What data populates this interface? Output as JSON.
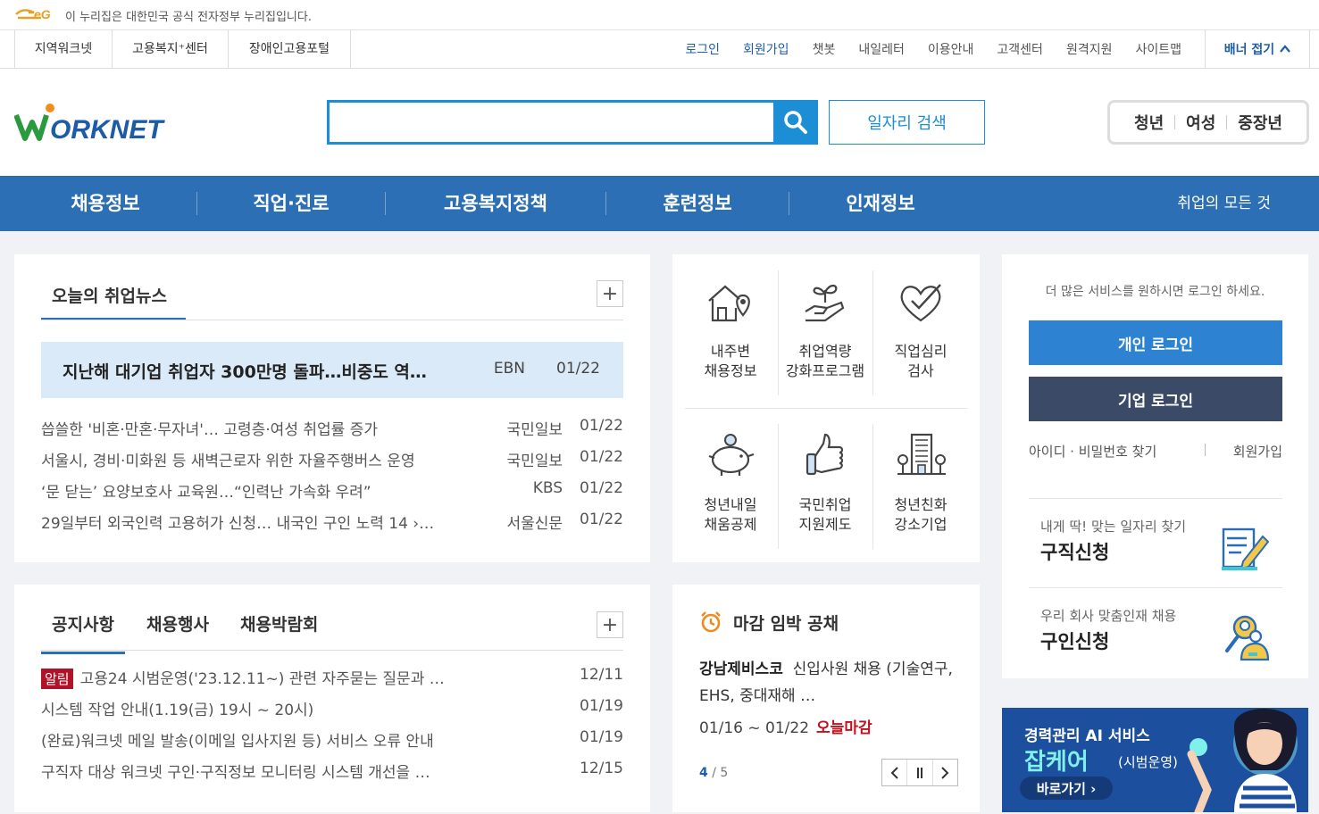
{
  "gov_bar": {
    "text": "이 누리집은 대한민국 공식 전자정부 누리집입니다."
  },
  "site_tabs": [
    "지역워크넷",
    "고용복지⁺센터",
    "장애인고용포털"
  ],
  "util_links": [
    {
      "label": "로그인",
      "highlight": true
    },
    {
      "label": "회원가입",
      "highlight": true
    },
    {
      "label": "챗봇",
      "highlight": false
    },
    {
      "label": "내일레터",
      "highlight": false
    },
    {
      "label": "이용안내",
      "highlight": false
    },
    {
      "label": "고객센터",
      "highlight": false
    },
    {
      "label": "원격지원",
      "highlight": false
    },
    {
      "label": "사이트맵",
      "highlight": false
    }
  ],
  "banner_fold": "배너 접기",
  "logo_text": "WORKNET",
  "search": {
    "value": "",
    "placeholder": ""
  },
  "job_search_button": "일자리 검색",
  "target_tabs": [
    "청년",
    "여성",
    "중장년"
  ],
  "gnb": [
    "채용정보",
    "직업·진로",
    "고용복지정책",
    "훈련정보",
    "인재정보"
  ],
  "gnb_all": "취업의 모든 것",
  "news": {
    "title": "오늘의 취업뉴스",
    "headline": {
      "title": "지난해 대기업 취업자 300만명 돌파…비중도 역…",
      "source": "EBN",
      "date": "01/22"
    },
    "items": [
      {
        "title": "씁쓸한 '비혼·만혼·무자녀'… 고령층·여성 취업률 증가",
        "source": "국민일보",
        "date": "01/22"
      },
      {
        "title": "서울시, 경비·미화원 등 새벽근로자 위한 자율주행버스 운영",
        "source": "국민일보",
        "date": "01/22"
      },
      {
        "title": "‘문 닫는’ 요양보호사 교육원…“인력난 가속화 우려”",
        "source": "KBS",
        "date": "01/22"
      },
      {
        "title": "29일부터 외국인력 고용허가 신청… 내국인 구인 노력 14  ›…",
        "source": "서울신문",
        "date": "01/22"
      }
    ]
  },
  "services": [
    {
      "line1": "내주변",
      "line2": "채용정보",
      "icon": "house-location-icon"
    },
    {
      "line1": "취업역량",
      "line2": "강화프로그램",
      "icon": "plant-hand-icon"
    },
    {
      "line1": "직업심리",
      "line2": "검사",
      "icon": "heart-check-icon"
    },
    {
      "line1": "청년내일",
      "line2": "채움공제",
      "icon": "piggy-bank-icon"
    },
    {
      "line1": "국민취업",
      "line2": "지원제도",
      "icon": "thumbs-up-icon"
    },
    {
      "line1": "청년친화",
      "line2": "강소기업",
      "icon": "building-icon"
    }
  ],
  "login": {
    "message": "더 많은 서비스를 원하시면 로그인 하세요.",
    "personal": "개인 로그인",
    "company": "기업 로그인",
    "find": "아이디 · 비밀번호 찾기",
    "join": "회원가입"
  },
  "quick": [
    {
      "sub": "내게 딱! 맞는 일자리 찾기",
      "main": "구직신청",
      "icon": "document-pen-icon"
    },
    {
      "sub": "우리 회사 맞춤인재 채용",
      "main": "구인신청",
      "icon": "person-search-icon"
    }
  ],
  "notice": {
    "tabs": [
      "공지사항",
      "채용행사",
      "채용박람회"
    ],
    "badge": "알림",
    "items": [
      {
        "title": "고용24 시범운영('23.12.11~) 관련 자주묻는 질문과 …",
        "date": "12/11",
        "badge": true
      },
      {
        "title": "시스템 작업 안내(1.19(금) 19시 ~ 20시)",
        "date": "01/19",
        "badge": false
      },
      {
        "title": "(완료)워크넷 메일 발송(이메일 입사지원 등) 서비스 오류 안내",
        "date": "01/19",
        "badge": false
      },
      {
        "title": "구직자 대상 워크넷 구인·구직정보 모니터링 시스템 개선을 …",
        "date": "12/15",
        "badge": false
      }
    ]
  },
  "deadline": {
    "title": "마감 임박 공채",
    "company": "강남제비스코",
    "desc": "신입사원 채용 (기술연구, EHS, 중대재해 …",
    "period": "01/16 ~ 01/22",
    "today": "오늘마감",
    "page_current": "4",
    "page_total": "/ 5"
  },
  "ai_banner": {
    "line1": "경력관리 AI 서비스",
    "line2": "잡케어",
    "line2_suffix": "(시범운영)",
    "go": "바로가기 ›"
  },
  "colors": {
    "primary": "#2d6fb4",
    "accent": "#1b8ed6",
    "alert": "#b01228"
  }
}
